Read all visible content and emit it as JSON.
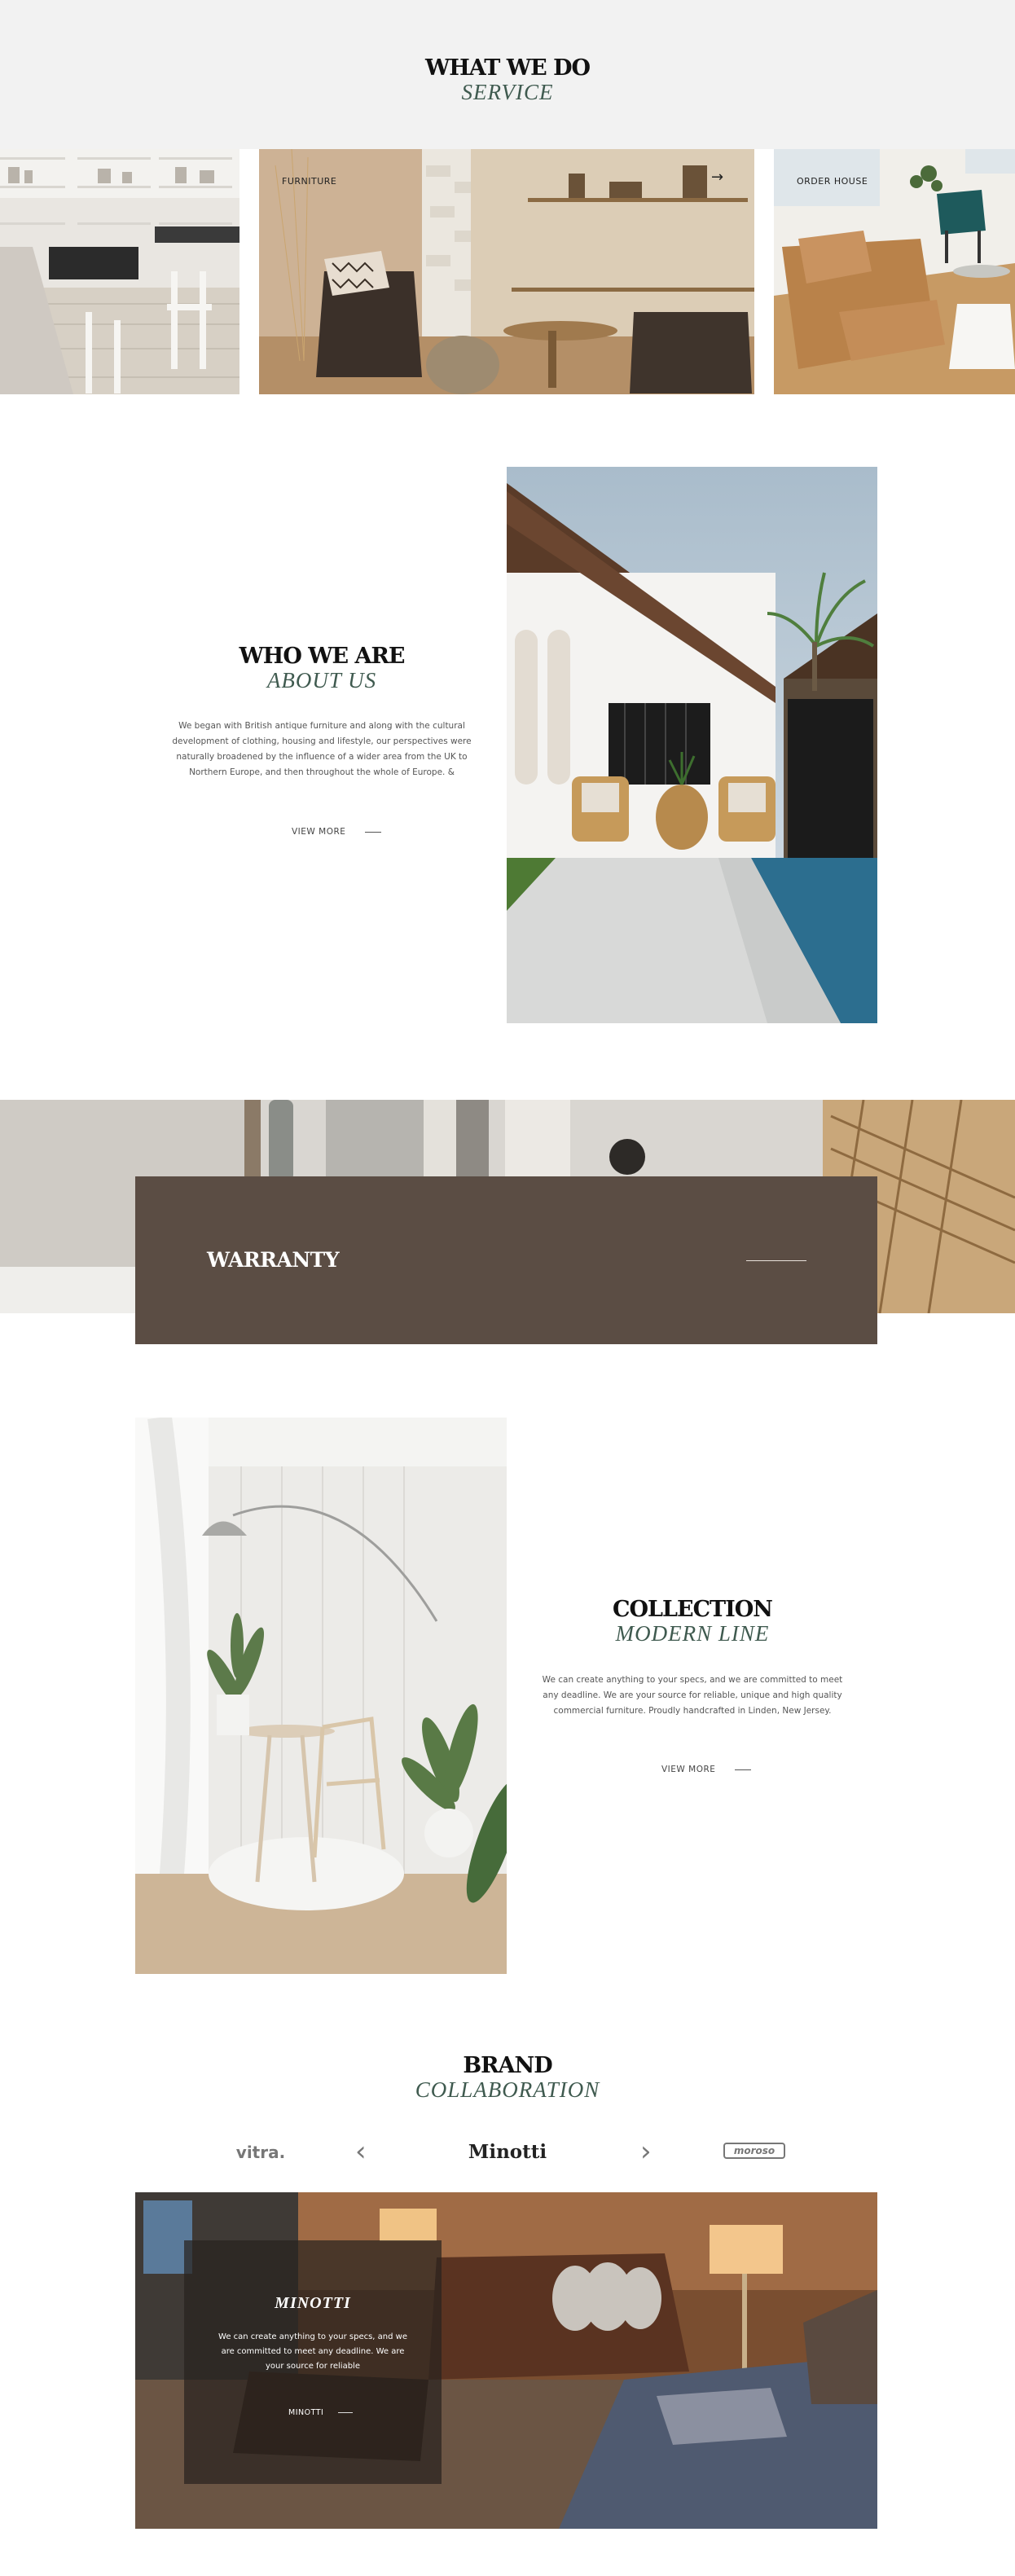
{
  "what_we_do": {
    "title": "WHAT WE DO",
    "subtitle": "SERVICE",
    "tiles": [
      {
        "label": ""
      },
      {
        "label": "FURNITURE",
        "arrow": "→"
      },
      {
        "label": "ORDER HOUSE"
      }
    ]
  },
  "who_we_are": {
    "title": "WHO WE ARE",
    "subtitle": "ABOUT US",
    "paragraph_lines": [
      "We began with British antique furniture and along with the cultural",
      "development of clothing, housing and lifestyle, our perspectives were",
      "naturally broadened by the influence of a wider area from the UK to",
      "Northern Europe, and then throughout the whole of Europe. &"
    ],
    "more_label": "VIEW MORE"
  },
  "warranty": {
    "title": "WARRANTY"
  },
  "collection": {
    "title": "COLLECTION",
    "subtitle": "MODERN LINE",
    "paragraph_lines": [
      "We can create anything to your specs, and we are committed to meet",
      "any deadline. We are your source for reliable, unique and high quality",
      "commercial furniture. Proudly handcrafted in Linden, New Jersey."
    ],
    "more_label": "VIEW MORE"
  },
  "brand": {
    "title": "BRAND",
    "subtitle": "COLLABORATION",
    "logos": [
      "vitra.",
      "Minotti",
      "moroso"
    ],
    "prev_arrow": "‹",
    "next_arrow": "›",
    "feature": {
      "name": "MINOTTI",
      "text_lines": [
        "We can create anything to your specs, and we",
        "are committed to meet any deadline. We are",
        "your source for reliable"
      ],
      "more_label": "MINOTTI"
    }
  },
  "colors": {
    "accent_green": "#3f5a4f",
    "warranty_brown": "#5b4d44",
    "section_gray": "#f2f2f2"
  }
}
